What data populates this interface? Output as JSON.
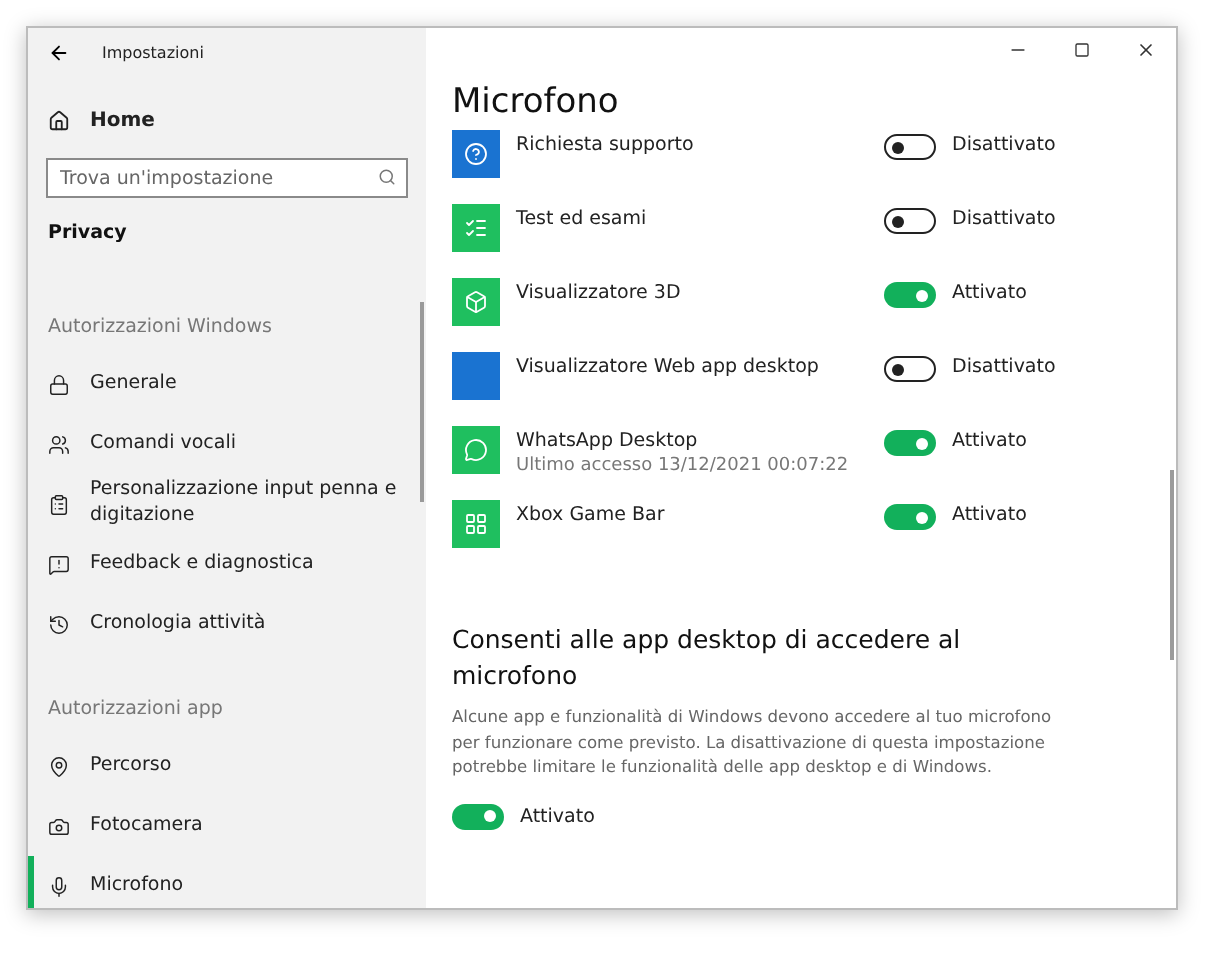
{
  "window": {
    "title": "Impostazioni"
  },
  "sidebar": {
    "home": "Home",
    "search": {
      "placeholder": "Trova un'impostazione"
    },
    "category": "Privacy",
    "sections": [
      {
        "header": "Autorizzazioni Windows",
        "items": [
          {
            "label": "Generale",
            "selected": false
          },
          {
            "label": "Comandi vocali",
            "selected": false
          },
          {
            "label": "Personalizzazione input penna e digitazione",
            "selected": false
          },
          {
            "label": "Feedback e diagnostica",
            "selected": false
          },
          {
            "label": "Cronologia attività",
            "selected": false
          }
        ]
      },
      {
        "header": "Autorizzazioni app",
        "items": [
          {
            "label": "Percorso",
            "selected": false
          },
          {
            "label": "Fotocamera",
            "selected": false
          },
          {
            "label": "Microfono",
            "selected": true
          }
        ]
      }
    ]
  },
  "content": {
    "title": "Microfono",
    "apps": [
      {
        "name": "Richiesta supporto",
        "color": "#1a73d1",
        "on": false,
        "state": "Disattivato"
      },
      {
        "name": "Test ed esami",
        "color": "#1fbf5f",
        "on": false,
        "state": "Disattivato"
      },
      {
        "name": "Visualizzatore 3D",
        "color": "#1fbf5f",
        "on": true,
        "state": "Attivato"
      },
      {
        "name": "Visualizzatore Web app desktop",
        "color": "#1a73d1",
        "on": false,
        "state": "Disattivato"
      },
      {
        "name": "WhatsApp Desktop",
        "subtitle": "Ultimo accesso 13/12/2021 00:07:22",
        "color": "#1fbf5f",
        "on": true,
        "state": "Attivato"
      },
      {
        "name": "Xbox Game Bar",
        "color": "#1fbf5f",
        "on": true,
        "state": "Attivato"
      }
    ],
    "desktop": {
      "heading": "Consenti alle app desktop di accedere al microfono",
      "description": "Alcune app e funzionalità di Windows devono accedere al tuo microfono per funzionare come previsto. La disattivazione di questa impostazione potrebbe limitare le funzionalità delle app desktop e di Windows.",
      "on": true,
      "state": "Attivato"
    }
  }
}
